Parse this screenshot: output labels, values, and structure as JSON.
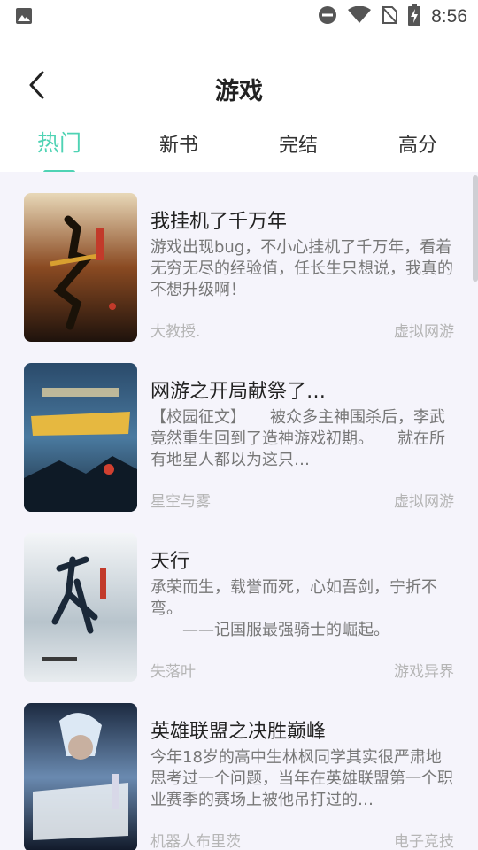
{
  "status_bar": {
    "time": "8:56",
    "icons": [
      "gallery-icon",
      "do-not-disturb-icon",
      "wifi-icon",
      "no-sim-icon",
      "battery-charging-icon"
    ]
  },
  "header": {
    "title": "游戏",
    "back_icon": "chevron-left-icon"
  },
  "tabs": [
    {
      "label": "热门",
      "active": true
    },
    {
      "label": "新书",
      "active": false
    },
    {
      "label": "完结",
      "active": false
    },
    {
      "label": "高分",
      "active": false
    }
  ],
  "accent_color": "#4fd3b4",
  "books": [
    {
      "title": "我挂机了千万年",
      "description": "游戏出现bug，不小心挂机了千万年，看着无穷无尽的经验值，任长生只想说，我真的不想升级啊！",
      "author": "大教授.",
      "genre": "虚拟网游"
    },
    {
      "title": "网游之开局献祭了…",
      "description": "【校园征文】　　被众多主神围杀后，李武竟然重生回到了造神游戏初期。　　就在所有地星人都以为这只…",
      "author": "星空与雾",
      "genre": "虚拟网游"
    },
    {
      "title": "天行",
      "description": "承荣而生，载誉而死，心如吾剑，宁折不弯。\n　　——记国服最强骑士的崛起。",
      "author": "失落叶",
      "genre": "游戏异界"
    },
    {
      "title": "英雄联盟之决胜巅峰",
      "description": "今年18岁的高中生林枫同学其实很严肃地思考过一个问题，当年在英雄联盟第一个职业赛季的赛场上被他吊打过的…",
      "author": "机器人布里茨",
      "genre": "电子竞技"
    }
  ]
}
